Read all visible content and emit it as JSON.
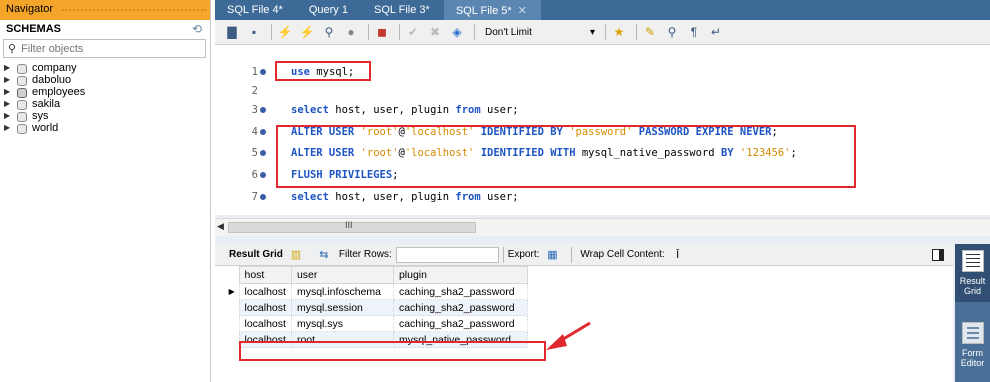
{
  "navigator": {
    "title": "Navigator",
    "schemas_label": "SCHEMAS",
    "filter_placeholder": "Filter objects",
    "schemas": [
      "company",
      "daboluo",
      "employees",
      "sakila",
      "sys",
      "world"
    ]
  },
  "tabs": [
    {
      "label": "SQL File 4*"
    },
    {
      "label": "Query 1"
    },
    {
      "label": "SQL File 3*"
    },
    {
      "label": "SQL File 5*"
    }
  ],
  "toolbar": {
    "limit_label": "Don't Limit"
  },
  "editor": {
    "lines": [
      {
        "num": "1",
        "dot": true,
        "text": "use mysql;"
      },
      {
        "num": "2",
        "dot": false,
        "text": ""
      },
      {
        "num": "3",
        "dot": true,
        "text": "select host, user, plugin from user;"
      },
      {
        "num": "4",
        "dot": true,
        "text": "ALTER USER 'root'@'localhost' IDENTIFIED BY 'password' PASSWORD EXPIRE NEVER;"
      },
      {
        "num": "5",
        "dot": true,
        "text": "ALTER USER 'root'@'localhost' IDENTIFIED WITH mysql_native_password BY '123456';"
      },
      {
        "num": "6",
        "dot": true,
        "text": "FLUSH PRIVILEGES;"
      },
      {
        "num": "7",
        "dot": true,
        "text": "select host, user, plugin from user;"
      }
    ],
    "scroll_grip": "III"
  },
  "results": {
    "result_grid_label": "Result Grid",
    "filter_rows_label": "Filter Rows:",
    "export_label": "Export:",
    "wrap_label": "Wrap Cell Content:",
    "columns": [
      "host",
      "user",
      "plugin"
    ],
    "rows": [
      [
        "localhost",
        "mysql.infoschema",
        "caching_sha2_password"
      ],
      [
        "localhost",
        "mysql.session",
        "caching_sha2_password"
      ],
      [
        "localhost",
        "mysql.sys",
        "caching_sha2_password"
      ],
      [
        "localhost",
        "root",
        "mysql_native_password"
      ]
    ]
  },
  "side_panel": {
    "result_grid": "Result Grid",
    "form_editor": "Form Editor"
  },
  "colors": {
    "tab_bar": "#3d6a97",
    "navigator_header": "#f4a52a",
    "highlight": "#e0282e"
  }
}
